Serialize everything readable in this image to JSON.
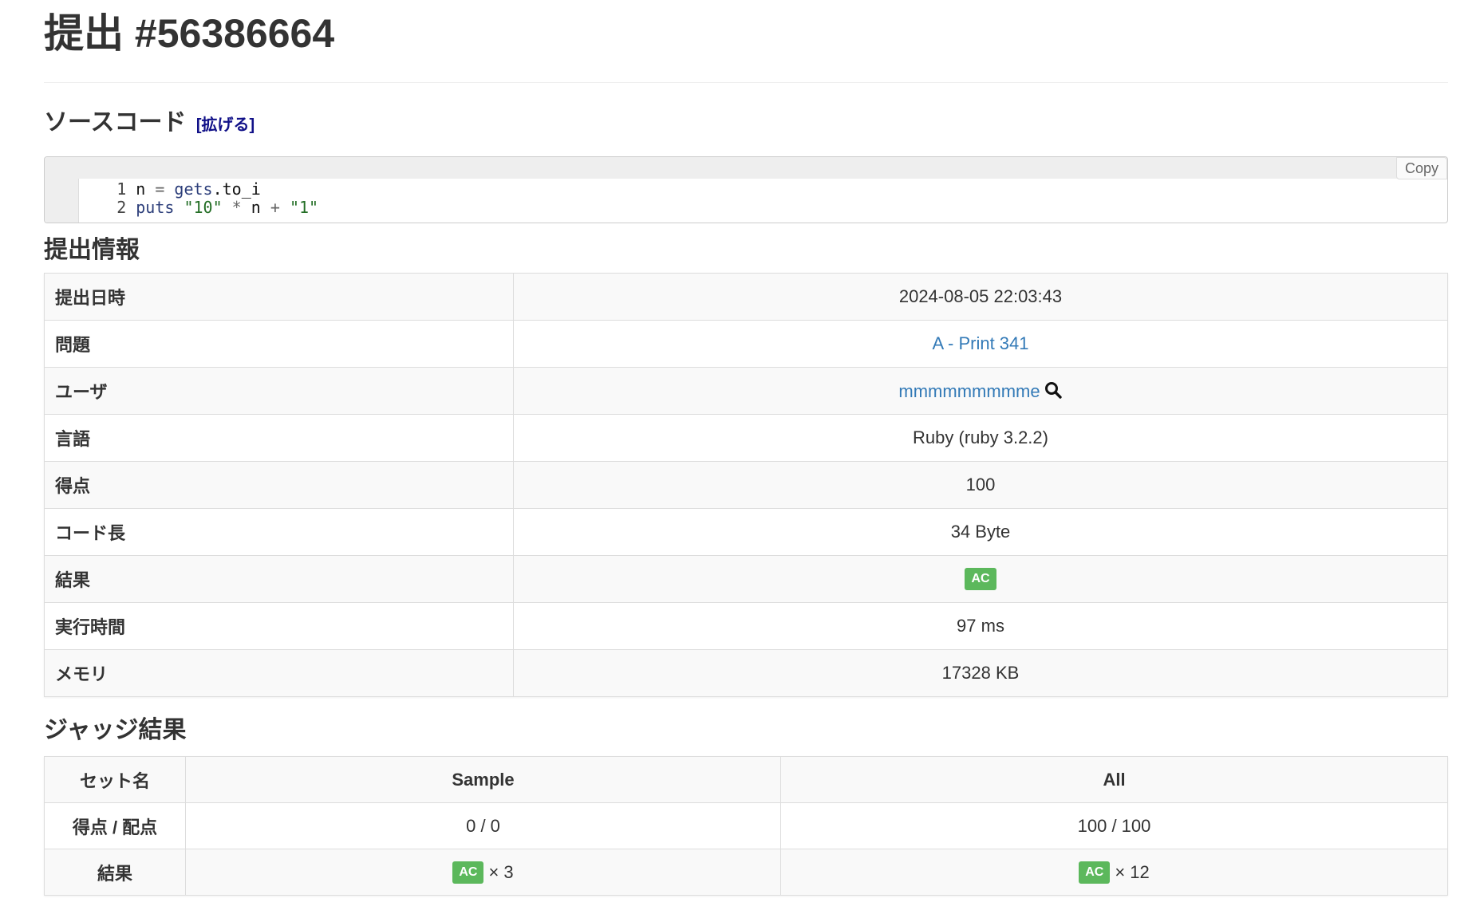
{
  "page": {
    "title": "提出 #56386664"
  },
  "source": {
    "heading": "ソースコード",
    "expand_label": "[拡げる]",
    "copy_label": "Copy",
    "lines": [
      {
        "number": "1",
        "tokens": [
          "n",
          " = ",
          "gets",
          ".to_i"
        ]
      },
      {
        "number": "2",
        "tokens": [
          "puts",
          " ",
          "\"10\"",
          " * ",
          "n",
          " + ",
          "\"1\""
        ]
      }
    ]
  },
  "info": {
    "heading": "提出情報",
    "rows": {
      "date": {
        "label": "提出日時",
        "value": "2024-08-05 22:03:43"
      },
      "task": {
        "label": "問題",
        "value": "A - Print 341"
      },
      "user": {
        "label": "ユーザ",
        "value": "mmmmmmmmme"
      },
      "language": {
        "label": "言語",
        "value": "Ruby (ruby 3.2.2)"
      },
      "score": {
        "label": "得点",
        "value": "100"
      },
      "code_length": {
        "label": "コード長",
        "value": "34 Byte"
      },
      "result": {
        "label": "結果",
        "value": "AC"
      },
      "exec_time": {
        "label": "実行時間",
        "value": "97 ms"
      },
      "memory": {
        "label": "メモリ",
        "value": "17328 KB"
      }
    }
  },
  "judge": {
    "heading": "ジャッジ結果",
    "header": {
      "set_name": "セット名",
      "sample": "Sample",
      "all": "All"
    },
    "score_row": {
      "label": "得点 / 配点",
      "sample": "0 / 0",
      "all": "100 / 100"
    },
    "result_row": {
      "label": "結果",
      "sample_badge": "AC",
      "sample_count": "× 3",
      "all_badge": "AC",
      "all_count": "× 12"
    }
  },
  "colors": {
    "link": "#337ab7",
    "expand_link": "#101088",
    "badge_success": "#5cb85c",
    "row_stripe": "#f9f9f9",
    "border": "#dddddd"
  }
}
